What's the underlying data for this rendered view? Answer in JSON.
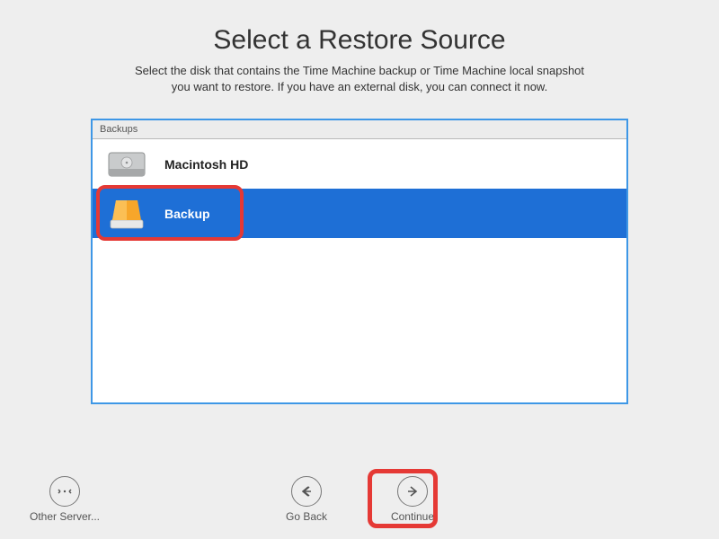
{
  "title": "Select a Restore Source",
  "subtitle_line1": "Select the disk that contains the Time Machine backup or Time Machine local snapshot",
  "subtitle_line2": "you want to restore. If you have an external disk, you can connect it now.",
  "list": {
    "header": "Backups",
    "items": [
      {
        "label": "Macintosh HD",
        "selected": false
      },
      {
        "label": "Backup",
        "selected": true
      }
    ]
  },
  "footer": {
    "other_server": "Other Server...",
    "go_back": "Go Back",
    "continue": "Continue"
  }
}
